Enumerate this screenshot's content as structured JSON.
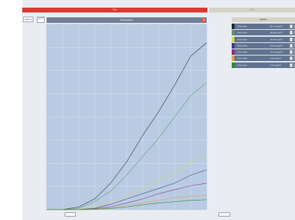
{
  "app": {
    "title_bar": "Titel",
    "right_bar": "Titel",
    "zoom_value": "100%",
    "y_stepper_top": "ug/m³",
    "y_stepper_bottom": "",
    "chart_header": "Messdaten",
    "panel_header": "Details"
  },
  "channels": [
    {
      "name": "Channel1",
      "value": "62,70 µg/m³",
      "color": "#1e2a3a"
    },
    {
      "name": "Channel2",
      "value": "48,60 µg/m³",
      "color": "#5c9a5c"
    },
    {
      "name": "Channel3",
      "value": "20,70 µg/m³",
      "color": "#d8d84a"
    },
    {
      "name": "Channel4",
      "value": "14,50 µg/m³",
      "color": "#3a3a8c"
    },
    {
      "name": "Channel5",
      "value": "10,20 µg/m³",
      "color": "#8a2a8a"
    },
    {
      "name": "Channel6",
      "value": "5,20 µg/m³",
      "color": "#e0a040"
    },
    {
      "name": "Channel7",
      "value": "3,70 µg/m³",
      "color": "#2a8a2a"
    }
  ],
  "chart_data": {
    "type": "line",
    "title": "Messdaten",
    "xlabel": "",
    "ylabel": "",
    "x_labels": [
      "",
      "",
      ""
    ],
    "x": [
      0,
      10,
      20,
      30,
      40,
      50,
      60,
      70,
      80,
      90,
      100
    ],
    "ylim": [
      0,
      70
    ],
    "xlim": [
      0,
      100
    ],
    "grid": true,
    "series": [
      {
        "color": "#1e2a3a",
        "values": [
          0,
          0,
          1,
          4,
          10,
          18,
          28,
          37,
          47,
          58,
          63
        ]
      },
      {
        "color": "#5c9a5c",
        "values": [
          0,
          0,
          0.5,
          3,
          7,
          13,
          20,
          27,
          35,
          43,
          48
        ]
      },
      {
        "color": "#d8d84a",
        "values": [
          0,
          0,
          0,
          1,
          3,
          5,
          8,
          11,
          14,
          18,
          21
        ]
      },
      {
        "color": "#3a3a8c",
        "values": [
          0,
          0,
          0,
          0.5,
          2,
          4,
          6,
          8,
          10,
          13,
          15
        ]
      },
      {
        "color": "#8a2a8a",
        "values": [
          0,
          0,
          0,
          0.3,
          1,
          2.5,
          4,
          6,
          7.5,
          9,
          10
        ]
      },
      {
        "color": "#e0a040",
        "values": [
          0,
          0,
          0,
          0.2,
          0.6,
          1.5,
          2.5,
          3.5,
          4.5,
          5,
          5.5
        ]
      },
      {
        "color": "#2a8a2a",
        "values": [
          0,
          0,
          0,
          0.1,
          0.4,
          1,
          1.8,
          2.5,
          3,
          3.5,
          3.7
        ]
      }
    ]
  }
}
